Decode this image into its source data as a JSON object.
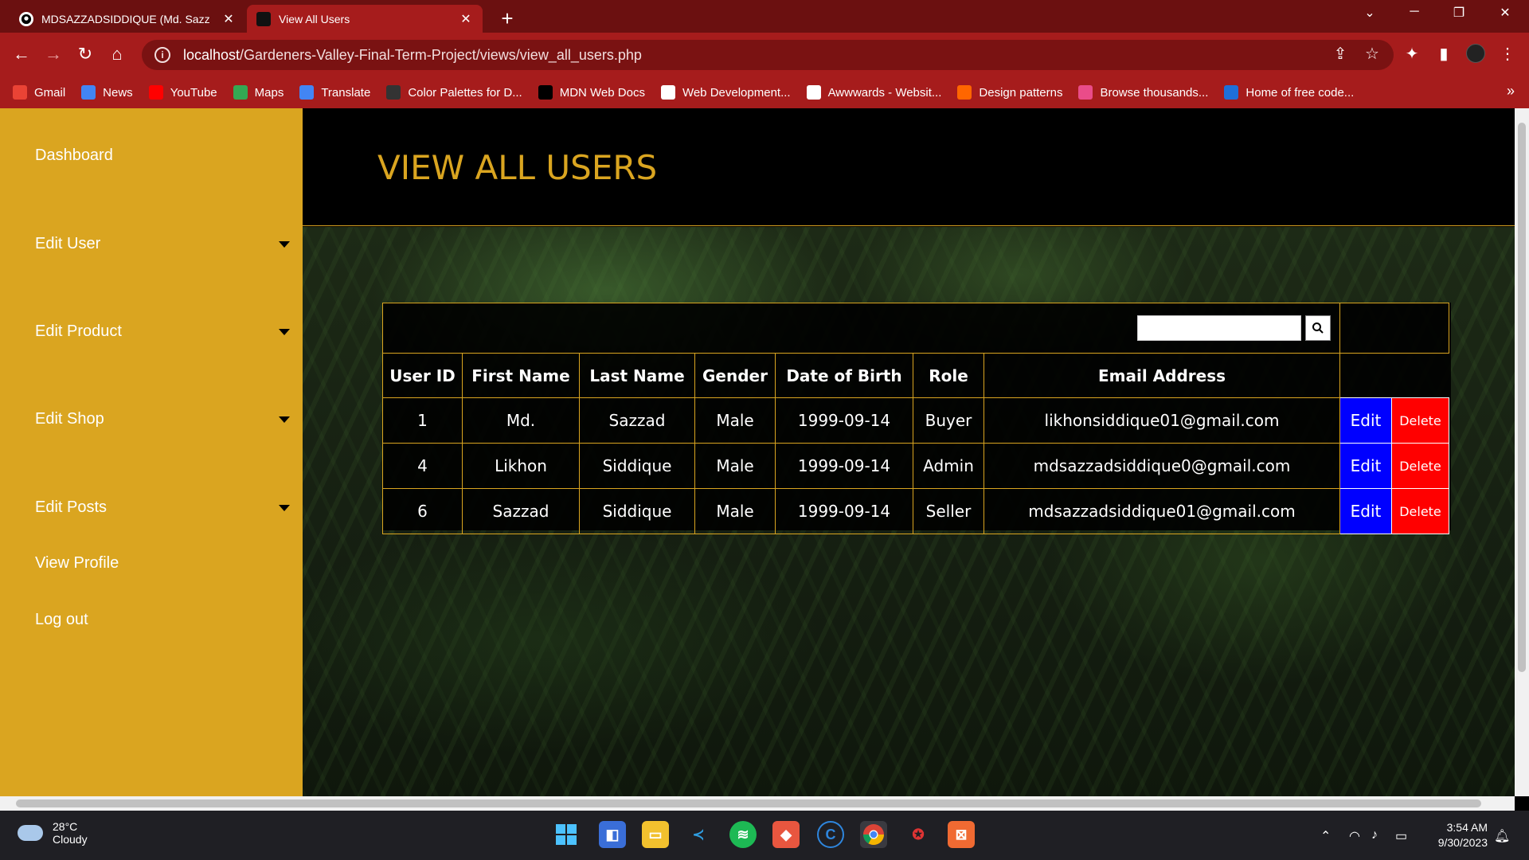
{
  "browser": {
    "tabs": [
      {
        "title": "MDSAZZADSIDDIQUE (Md. Sazz",
        "icon": "github-icon",
        "active": false
      },
      {
        "title": "View All Users",
        "icon": "site-favicon",
        "active": true
      }
    ],
    "url_host": "localhost",
    "url_path": "/Gardeners-Valley-Final-Term-Project/views/view_all_users.php",
    "bookmarks": [
      {
        "label": "Gmail",
        "icon": "gmail-icon",
        "color": "#ea4335"
      },
      {
        "label": "News",
        "icon": "news-icon",
        "color": "#4285f4"
      },
      {
        "label": "YouTube",
        "icon": "youtube-icon",
        "color": "#ff0000"
      },
      {
        "label": "Maps",
        "icon": "maps-icon",
        "color": "#34a853"
      },
      {
        "label": "Translate",
        "icon": "translate-icon",
        "color": "#4285f4"
      },
      {
        "label": "Color Palettes for D...",
        "icon": "palette-icon",
        "color": "#333333"
      },
      {
        "label": "MDN Web Docs",
        "icon": "mdn-icon",
        "color": "#000000"
      },
      {
        "label": "Web Development...",
        "icon": "webdev-icon",
        "color": "#ffffff"
      },
      {
        "label": "Awwwards - Websit...",
        "icon": "awwwards-icon",
        "color": "#ffffff"
      },
      {
        "label": "Design patterns",
        "icon": "ui-icon",
        "color": "#ff6600"
      },
      {
        "label": "Browse thousands...",
        "icon": "dribbble-icon",
        "color": "#ea4c89"
      },
      {
        "label": "Home of free code...",
        "icon": "bootstrap-icon",
        "color": "#1e6fd9"
      }
    ]
  },
  "sidebar": {
    "items": [
      {
        "label": "Dashboard",
        "has_caret": false
      },
      {
        "label": "Edit User",
        "has_caret": true
      },
      {
        "label": "Edit Product",
        "has_caret": true
      },
      {
        "label": "Edit Shop",
        "has_caret": true
      },
      {
        "label": "Edit Posts",
        "has_caret": true
      },
      {
        "label": "View Profile",
        "has_caret": false
      },
      {
        "label": "Log out",
        "has_caret": false
      }
    ]
  },
  "page": {
    "title": "VIEW ALL USERS",
    "search_value": ""
  },
  "table": {
    "headers": [
      "User ID",
      "First Name",
      "Last Name",
      "Gender",
      "Date of Birth",
      "Role",
      "Email Address"
    ],
    "rows": [
      [
        "1",
        "Md.",
        "Sazzad",
        "Male",
        "1999-09-14",
        "Buyer",
        "likhonsiddique01@gmail.com"
      ],
      [
        "4",
        "Likhon",
        "Siddique",
        "Male",
        "1999-09-14",
        "Admin",
        "mdsazzadsiddique0@gmail.com"
      ],
      [
        "6",
        "Sazzad",
        "Siddique",
        "Male",
        "1999-09-14",
        "Seller",
        "mdsazzadsiddique01@gmail.com"
      ]
    ],
    "edit_label": "Edit",
    "delete_label": "Delete"
  },
  "taskbar": {
    "weather_temp": "28°C",
    "weather_desc": "Cloudy",
    "time": "3:54 AM",
    "date": "9/30/2023"
  },
  "colors": {
    "accent_gold": "#daa520",
    "edit_blue": "#0000ff",
    "delete_red": "#ff0000",
    "chrome_red": "#a61c1c"
  }
}
